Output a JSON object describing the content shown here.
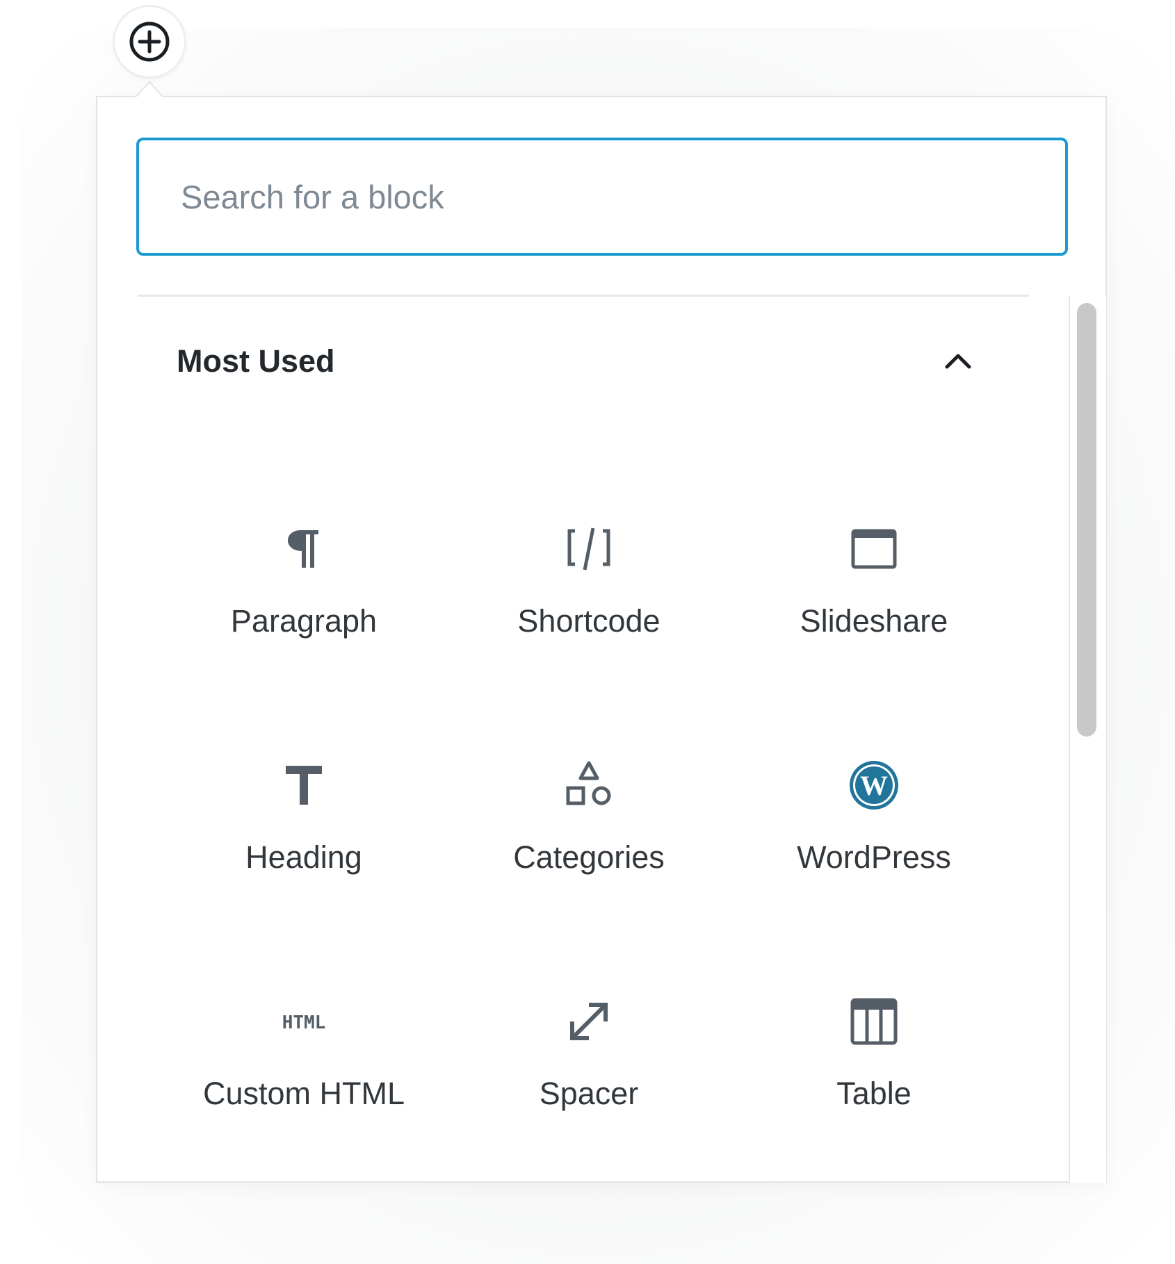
{
  "inserter": {
    "toggle_icon": "plus-circle-icon",
    "search": {
      "placeholder": "Search for a block",
      "value": ""
    },
    "panel": {
      "title": "Most Used",
      "collapse_icon": "chevron-up-icon",
      "expanded": true
    },
    "blocks": [
      {
        "label": "Paragraph",
        "icon": "paragraph-icon"
      },
      {
        "label": "Shortcode",
        "icon": "shortcode-icon"
      },
      {
        "label": "Slideshare",
        "icon": "slideshare-icon"
      },
      {
        "label": "Heading",
        "icon": "heading-icon"
      },
      {
        "label": "Categories",
        "icon": "categories-icon"
      },
      {
        "label": "WordPress",
        "icon": "wordpress-icon"
      },
      {
        "label": "Custom HTML",
        "icon": "html-icon"
      },
      {
        "label": "Spacer",
        "icon": "spacer-icon"
      },
      {
        "label": "Table",
        "icon": "table-icon"
      }
    ],
    "colors": {
      "focus_border": "#1a9ad0",
      "icon": "#555d66",
      "wordpress_brand": "#21759b",
      "text": "#32373c"
    }
  }
}
